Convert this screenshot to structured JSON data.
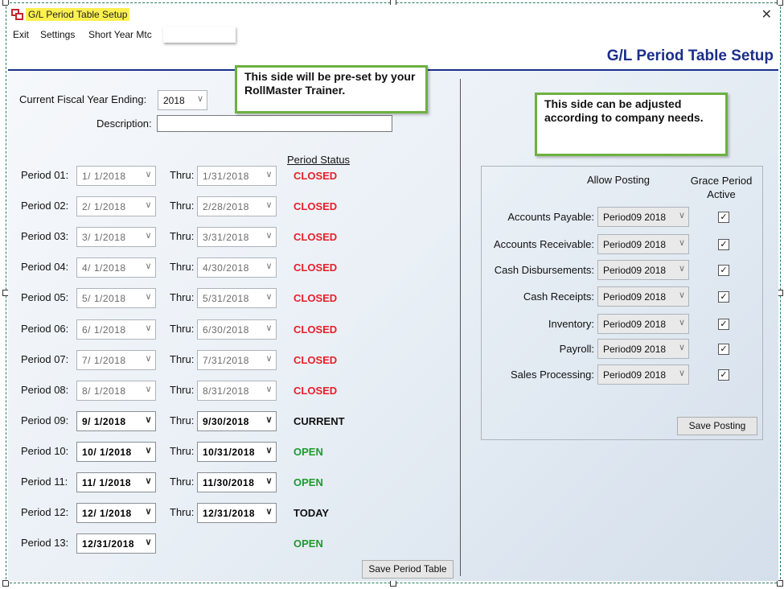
{
  "window": {
    "title": "G/L Period Table Setup",
    "close_glyph": "✕"
  },
  "menu": {
    "items": [
      "Exit",
      "Settings",
      "Short Year Mtc"
    ]
  },
  "header": {
    "title": "G/L Period Table Setup"
  },
  "callouts": {
    "left": "This side will be pre-set by your RollMaster Trainer.",
    "right": "This side can be adjusted according to company needs."
  },
  "form": {
    "fiscal_year_label": "Current Fiscal Year Ending:",
    "fiscal_year_value": "2018",
    "description_label": "Description:",
    "description_value": "",
    "period_status_header": "Period Status",
    "thru_label": "Thru:",
    "chevron": "∨"
  },
  "periods": [
    {
      "label": "Period 01:",
      "start": "1/ 1/2018",
      "end": "1/31/2018",
      "status": "CLOSED",
      "enabled": false
    },
    {
      "label": "Period 02:",
      "start": "2/ 1/2018",
      "end": "2/28/2018",
      "status": "CLOSED",
      "enabled": false
    },
    {
      "label": "Period 03:",
      "start": "3/ 1/2018",
      "end": "3/31/2018",
      "status": "CLOSED",
      "enabled": false
    },
    {
      "label": "Period 04:",
      "start": "4/ 1/2018",
      "end": "4/30/2018",
      "status": "CLOSED",
      "enabled": false
    },
    {
      "label": "Period 05:",
      "start": "5/ 1/2018",
      "end": "5/31/2018",
      "status": "CLOSED",
      "enabled": false
    },
    {
      "label": "Period 06:",
      "start": "6/ 1/2018",
      "end": "6/30/2018",
      "status": "CLOSED",
      "enabled": false
    },
    {
      "label": "Period 07:",
      "start": "7/ 1/2018",
      "end": "7/31/2018",
      "status": "CLOSED",
      "enabled": false
    },
    {
      "label": "Period 08:",
      "start": "8/ 1/2018",
      "end": "8/31/2018",
      "status": "CLOSED",
      "enabled": false
    },
    {
      "label": "Period 09:",
      "start": "9/ 1/2018",
      "end": "9/30/2018",
      "status": "CURRENT",
      "enabled": true
    },
    {
      "label": "Period 10:",
      "start": "10/ 1/2018",
      "end": "10/31/2018",
      "status": "OPEN",
      "enabled": true
    },
    {
      "label": "Period 11:",
      "start": "11/ 1/2018",
      "end": "11/30/2018",
      "status": "OPEN",
      "enabled": true
    },
    {
      "label": "Period 12:",
      "start": "12/ 1/2018",
      "end": "12/31/2018",
      "status": "TODAY",
      "enabled": true
    },
    {
      "label": "Period 13:",
      "start": "12/31/2018",
      "end": "",
      "status": "OPEN",
      "enabled": true
    }
  ],
  "status_colors": {
    "CLOSED": "#e8202a",
    "OPEN": "#1f9a2e",
    "CURRENT": "#111111",
    "TODAY": "#111111"
  },
  "save_period_button": "Save Period Table",
  "posting": {
    "allow_header": "Allow Posting",
    "grace_header": "Grace Period Active",
    "rows": [
      {
        "label": "Accounts Payable:",
        "value": "Period09 2018",
        "grace": true
      },
      {
        "label": "Accounts Receivable:",
        "value": "Period09 2018",
        "grace": true
      },
      {
        "label": "Cash Disbursements:",
        "value": "Period09 2018",
        "grace": true
      },
      {
        "label": "Cash Receipts:",
        "value": "Period09 2018",
        "grace": true
      },
      {
        "label": "Inventory:",
        "value": "Period09 2018",
        "grace": true
      },
      {
        "label": "Payroll:",
        "value": "Period09 2018",
        "grace": true
      },
      {
        "label": "Sales Processing:",
        "value": "Period09 2018",
        "grace": true
      }
    ],
    "checkmark": "☑",
    "save_button": "Save Posting"
  }
}
